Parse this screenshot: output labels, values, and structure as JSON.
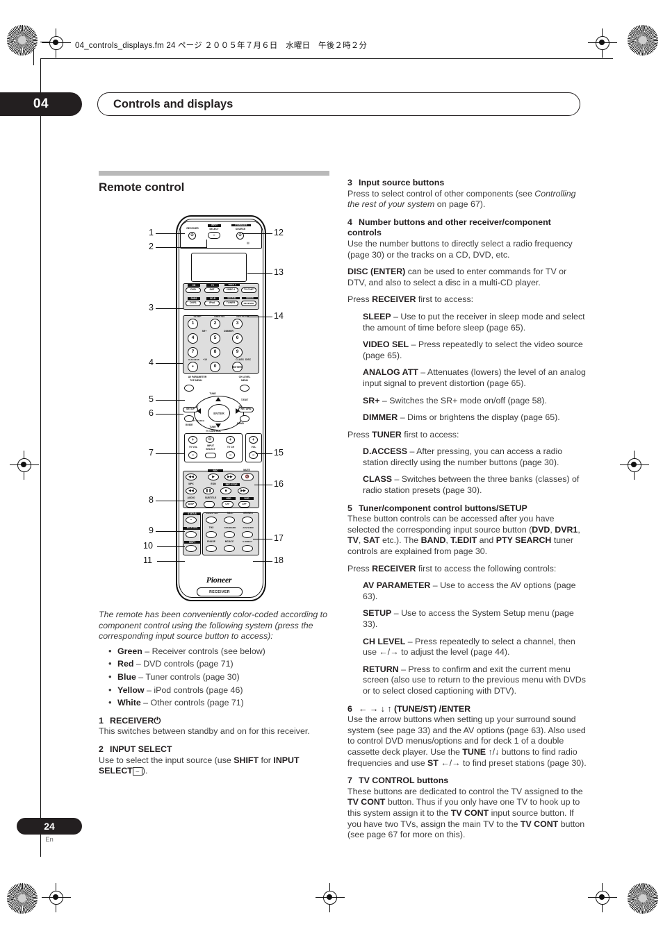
{
  "running_header": "04_controls_displays.fm  24 ページ  ２００５年７月６日　水曜日　午後２時２分",
  "chapter": {
    "number": "04",
    "title": "Controls and displays"
  },
  "footer": {
    "page": "24",
    "language": "En"
  },
  "left_column": {
    "section_heading": "Remote control",
    "caption": "The remote has been conveniently color-coded according to component control using the following system (press the corresponding input source button to access):",
    "color_bullets": [
      {
        "color": "Green",
        "text": " – Receiver controls (see below)"
      },
      {
        "color": "Red",
        "text": " – DVD controls (page 71)"
      },
      {
        "color": "Blue",
        "text": " – Tuner controls (page 30)"
      },
      {
        "color": "Yellow",
        "text": " – iPod controls (page 46)"
      },
      {
        "color": "White",
        "text": " – Other controls (page 71)"
      }
    ],
    "items": [
      {
        "num": "1",
        "title": "RECEIVER⏻",
        "body": "This switches between standby and on for this receiver."
      },
      {
        "num": "2",
        "title": "INPUT SELECT",
        "body_pre": "Use to select the input source (use ",
        "body_b1": "SHIFT",
        "body_mid": " for ",
        "body_b2": "INPUT SELECT",
        "body_post": ")."
      }
    ]
  },
  "right_column": {
    "item3": {
      "num": "3",
      "title": "Input source buttons",
      "body_pre": "Press to select control of other components (see ",
      "body_italic": "Controlling the rest of your system",
      "body_post": " on page 67)."
    },
    "item4": {
      "num": "4",
      "title": "Number buttons and other receiver/component controls",
      "p1": "Use the number buttons to directly select a radio frequency (page 30) or the tracks on a CD, DVD, etc.",
      "p2_b": "DISC (ENTER)",
      "p2": " can be used to enter commands for TV or DTV, and also to select a disc in a multi-CD player.",
      "press_receiver_pre": "Press ",
      "press_receiver_b": "RECEIVER",
      "press_receiver_post": " first to access:",
      "receiver_subitems": [
        {
          "term": "SLEEP",
          "desc": " – Use to put the receiver in sleep mode and select the amount of time before sleep (page 65)."
        },
        {
          "term": "VIDEO SEL",
          "desc": " – Press repeatedly to select the video source (page 65)."
        },
        {
          "term": "ANALOG ATT",
          "desc": " – Attenuates (lowers) the level of an analog input signal to prevent distortion (page 65)."
        },
        {
          "term": "SR+",
          "desc": " – Switches the SR+ mode on/off (page 58)."
        },
        {
          "term": "DIMMER",
          "desc": " – Dims or brightens the display (page 65)."
        }
      ],
      "press_tuner_pre": "Press ",
      "press_tuner_b": "TUNER",
      "press_tuner_post": " first to access:",
      "tuner_subitems": [
        {
          "term": "D.ACCESS",
          "desc": " – After pressing, you can access a radio station directly using the number buttons (page 30)."
        },
        {
          "term": "CLASS",
          "desc": " – Switches between the three banks (classes) of radio station presets (page 30)."
        }
      ]
    },
    "item5": {
      "num": "5",
      "title": "Tuner/component control buttons/SETUP",
      "p1_a": "These button controls can be accessed after you have selected the corresponding input source button (",
      "p1_b1": "DVD",
      "p1_c": ", ",
      "p1_b2": "DVR1",
      "p1_d": ", ",
      "p1_b3": "TV",
      "p1_e": ", ",
      "p1_b4": "SAT",
      "p1_f": " etc.). The ",
      "p1_b5": "BAND",
      "p1_g": ", ",
      "p1_b6": "T.EDIT",
      "p1_h": " and ",
      "p1_b7": "PTY SEARCH",
      "p1_i": " tuner controls are explained from page 30.",
      "p2_pre": "Press ",
      "p2_b": "RECEIVER",
      "p2_post": " first to access the following controls:",
      "subitems": [
        {
          "term": "AV PARAMETER",
          "desc": " – Use to access the AV options (page 63)."
        },
        {
          "term": "SETUP",
          "desc": " – Use to access the System Setup menu (page 33)."
        },
        {
          "term": "CH LEVEL",
          "desc": " – Press repeatedly to select a channel, then use ←/→ to adjust the level (page 44)."
        },
        {
          "term": "RETURN",
          "desc": " – Press to confirm and exit the current menu screen (also use to return to the previous menu with DVDs or to select closed captioning with DTV)."
        }
      ]
    },
    "item6": {
      "num": "6",
      "title": "← → ↓ ↑ (TUNE/ST) /ENTER",
      "body_a": "Use the arrow buttons when setting up your surround sound system (see page 33) and the AV options (page 63). Also used to control DVD menus/options and for deck 1 of a double cassette deck player. Use the ",
      "body_b1": "TUNE",
      "body_b": " ↑/↓ buttons to find radio frequencies and use ",
      "body_b2": "ST",
      "body_c": " ←/→ to find preset stations (page 30)."
    },
    "item7": {
      "num": "7",
      "title": "TV CONTROL buttons",
      "body_a": "These buttons are dedicated to control the TV assigned to the ",
      "body_b1": "TV CONT",
      "body_b": " button. Thus if you only have one TV to hook up to this system assign it to the ",
      "body_b2": "TV CONT",
      "body_c": " input source button. If you have two TVs, assign the main TV to the ",
      "body_b3": "TV CONT",
      "body_d": " button (see page 67 for more on this)."
    }
  },
  "remote": {
    "top_labels": {
      "receiver": "RECEIVER",
      "input": "INPUT",
      "select": "SELECT",
      "system_off": "SYSTEM OFF",
      "source": "SOURCE"
    },
    "input_source_buttons": [
      {
        "over": "CD",
        "main": "DVD"
      },
      {
        "over": "TV",
        "main": "SAT"
      },
      {
        "over": "VIDEO 2",
        "main": "VIDEO 1"
      },
      {
        "over": "",
        "main": "TV CONT"
      },
      {
        "over": "DVR2",
        "main": "DVR1"
      },
      {
        "over": "CD-R",
        "main": "iPod"
      },
      {
        "over": "MULTI IN",
        "main": "TUNER"
      },
      {
        "over": "BD/DVD",
        "main": "RECEIVER"
      }
    ],
    "number_keys": [
      {
        "over": "SLEEP",
        "main": "1"
      },
      {
        "over": "VIDEO SEL",
        "main": "2"
      },
      {
        "over": "ANALOG ATT",
        "main": "3"
      },
      {
        "over": "SR+",
        "main": "4"
      },
      {
        "over": "DIMMER",
        "main": "5"
      },
      {
        "over": "",
        "main": "6"
      },
      {
        "over": "D.ACCESS",
        "main": "7"
      },
      {
        "over": "",
        "main": "8"
      },
      {
        "over": "CLASS",
        "main": "9"
      },
      {
        "over": "+10",
        "main": "•"
      },
      {
        "over": "",
        "main": "0"
      },
      {
        "over": "DISC",
        "main": "ENTER"
      }
    ],
    "nav_labels": {
      "av_parameter": "AV PARAMETER",
      "top_menu": "TOP MENU",
      "ch_level": "CH LEVEL",
      "menu": "MENU",
      "setup": "SETUP",
      "t_edit": "T.EDIT",
      "return": "RETURN",
      "guide": "GUIDE",
      "pty_search": "PTY SEARCH",
      "band": "BAND",
      "tune_up": "TUNE",
      "tune_dn": "TUNE",
      "st_left": "ST",
      "st_right": "ST",
      "enter": "ENTER"
    },
    "tv_control": {
      "title": "TV CONTROL",
      "tv_vol": "TV VOL",
      "input_select": "INPUT SELECT",
      "tv_ch": "TV CH",
      "vol": "VOL"
    },
    "transport": {
      "rec": "REC",
      "mute": "MUTE",
      "mpx": "MPX",
      "eon": "EON",
      "rec_stop": "REC STOP",
      "audio": "AUDIO",
      "subtitle": "SUBTITLE",
      "hdd": "HDD",
      "dvd": "DVD",
      "disp": "DISP",
      "ch_minus": "CH−",
      "ch_plus": "CH+"
    },
    "mode_buttons": [
      "STATUS",
      "SIGNAL SEL",
      "SBch",
      "STEREO",
      "MULTI OPE",
      "THX",
      "STANDARD",
      "ADV.SURR",
      "SHIFT",
      "PHASE",
      "MCACC",
      "S.DIRECT"
    ],
    "brand": "Pioneer",
    "mode_pill": "RECEIVER",
    "callouts": [
      "1",
      "2",
      "3",
      "4",
      "5",
      "6",
      "7",
      "8",
      "9",
      "10",
      "11",
      "12",
      "13",
      "14",
      "15",
      "16",
      "17",
      "18"
    ]
  }
}
